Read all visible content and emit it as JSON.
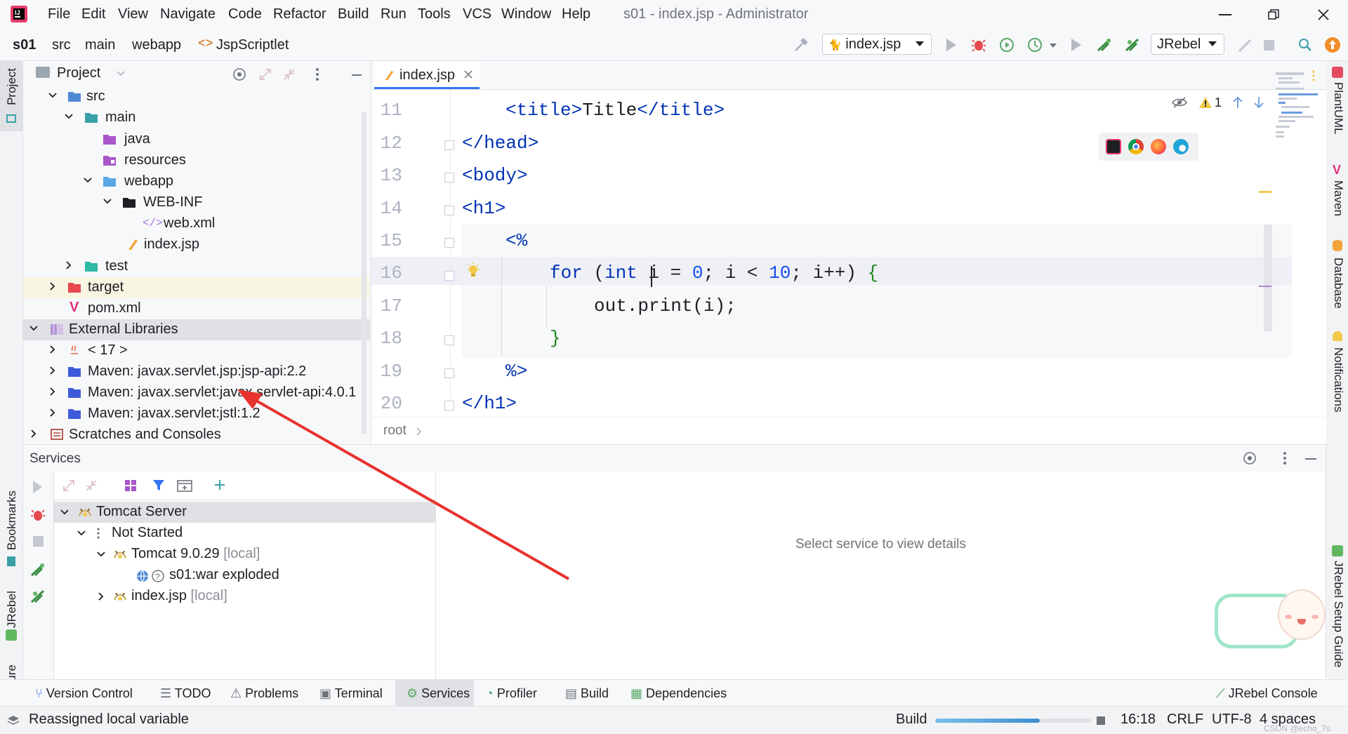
{
  "title_bar": {
    "menu": [
      "File",
      "Edit",
      "View",
      "Navigate",
      "Code",
      "Refactor",
      "Build",
      "Run",
      "Tools",
      "VCS",
      "Window",
      "Help"
    ],
    "window_title": "s01 - index.jsp - Administrator"
  },
  "nav_bar": {
    "breadcrumbs": [
      "s01",
      "src",
      "main",
      "webapp",
      "JspScriptlet"
    ],
    "run_config": "index.jsp",
    "jrebel_combo": "JRebel"
  },
  "left_strip": {
    "project": "Project",
    "bookmarks": "Bookmarks",
    "jrebel": "JRebel",
    "structure": "Structure"
  },
  "right_strip": {
    "plantuml": "PlantUML",
    "maven": "Maven",
    "database": "Database",
    "notifications": "Notifications",
    "jrebel_setup": "JRebel Setup Guide"
  },
  "project_panel": {
    "title": "Project",
    "tree": [
      {
        "label": "src"
      },
      {
        "label": "main"
      },
      {
        "label": "java"
      },
      {
        "label": "resources"
      },
      {
        "label": "webapp"
      },
      {
        "label": "WEB-INF"
      },
      {
        "label": "web.xml"
      },
      {
        "label": "index.jsp"
      },
      {
        "label": "test"
      },
      {
        "label": "target"
      },
      {
        "label": "pom.xml"
      },
      {
        "label": "External Libraries"
      },
      {
        "label": "< 17 >"
      },
      {
        "label": "Maven: javax.servlet.jsp:jsp-api:2.2"
      },
      {
        "label": "Maven: javax.servlet:javax.servlet-api:4.0.1"
      },
      {
        "label": "Maven: javax.servlet:jstl:1.2"
      },
      {
        "label": "Scratches and Consoles"
      }
    ]
  },
  "editor": {
    "tab": "index.jsp",
    "line_numbers": [
      "11",
      "12",
      "13",
      "14",
      "15",
      "16",
      "17",
      "18",
      "19",
      "20"
    ],
    "warning_count": "1",
    "breadcrumb": "root",
    "code": {
      "l11": {
        "open": "<title>",
        "text": "Title",
        "close": "</title>"
      },
      "l12": "</head>",
      "l13": "<body>",
      "l14": "<h1>",
      "l15": "<%",
      "l16": {
        "kw1": "for",
        "p1": " (",
        "kw2": "int",
        "v": " i",
        "eq": " = ",
        "n0": "0",
        "s1": "; i < ",
        "n10": "10",
        "s2": "; i++) ",
        "b": "{"
      },
      "l17": {
        "obj": "out.print(",
        "arg": "i",
        "end": ");"
      },
      "l18": "}",
      "l19": "%>",
      "l20": "</h1>"
    }
  },
  "services": {
    "title": "Services",
    "empty_message": "Select service to view details",
    "tree": {
      "server": "Tomcat Server",
      "status": "Not Started",
      "tomcat": "Tomcat 9.0.29",
      "tomcat_suffix": "[local]",
      "artifact": "s01:war exploded",
      "index": "index.jsp",
      "index_suffix": "[local]"
    }
  },
  "bottom_tabs": [
    "Version Control",
    "TODO",
    "Problems",
    "Terminal",
    "Services",
    "Profiler",
    "Build",
    "Dependencies",
    "JRebel Console"
  ],
  "status_bar": {
    "message": "Reassigned local variable",
    "build_label": "Build",
    "build_progress": 0.67,
    "position": "16:18",
    "line_ending": "CRLF",
    "encoding": "UTF-8",
    "indent": "4 spaces",
    "watermark": "CSDN @echo_7s."
  },
  "colors": {
    "accent": "#3574f0",
    "arrow": "#e8322d",
    "selection": "#dfe1e5",
    "target_bg": "#f8f5e2"
  }
}
